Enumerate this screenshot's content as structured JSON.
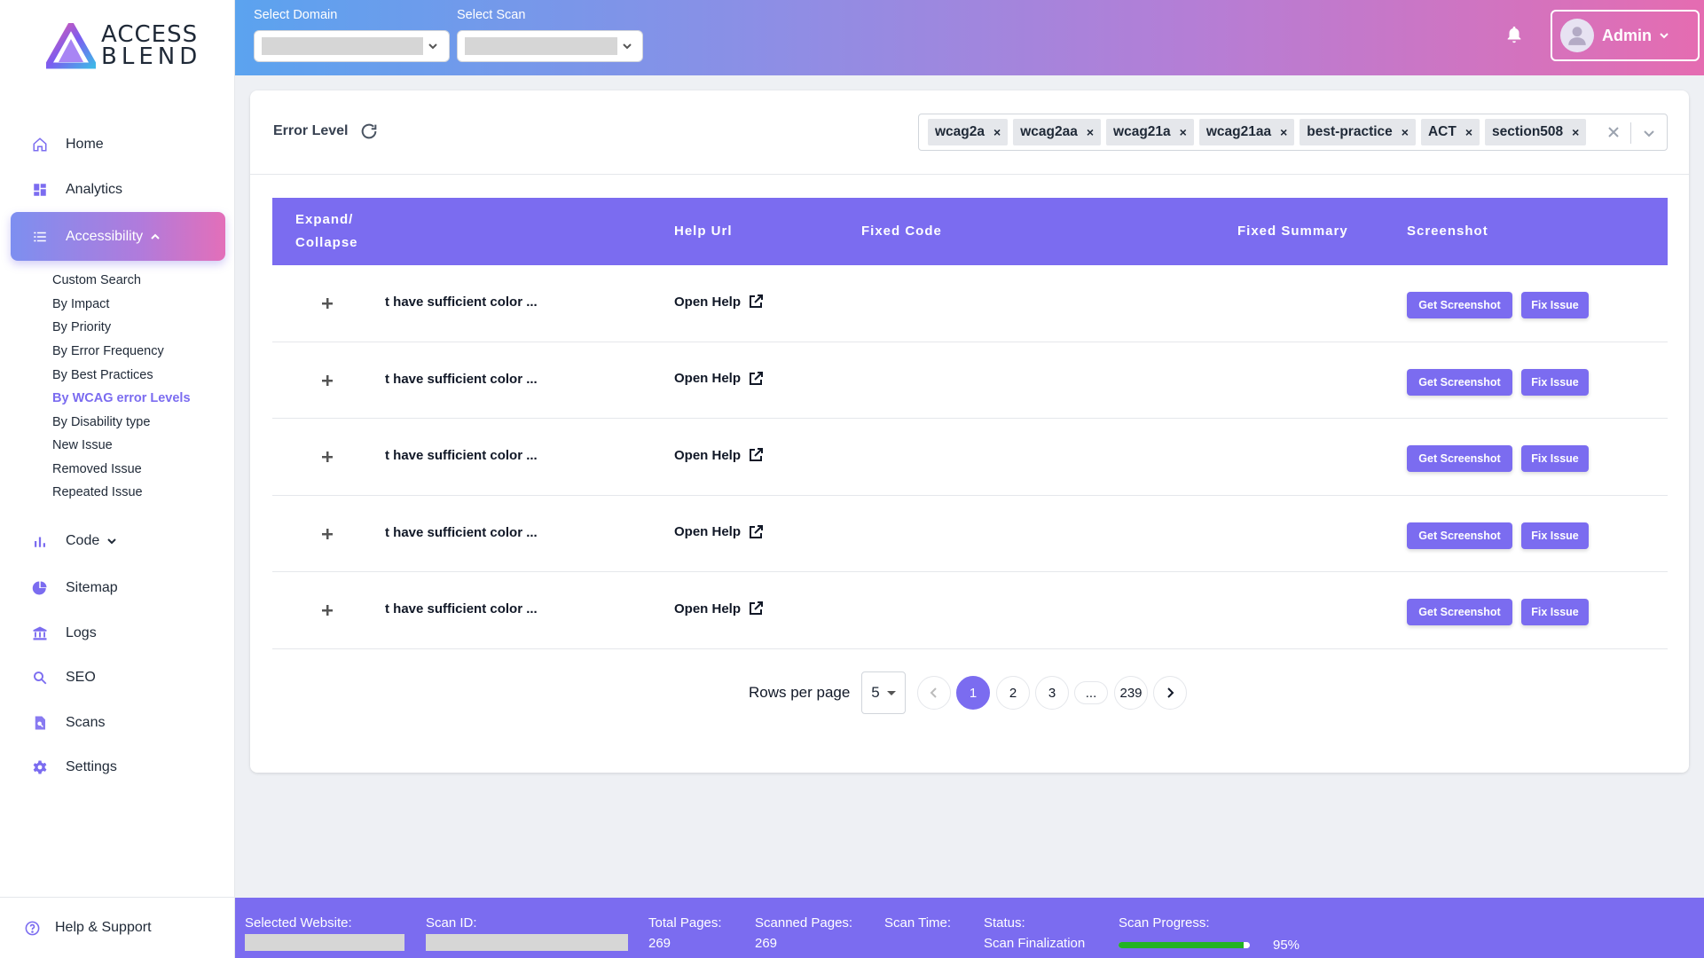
{
  "app": {
    "logo_line1": "ACCESS",
    "logo_line2": "BLEND"
  },
  "sidebar": {
    "items": [
      {
        "label": "Home",
        "icon": "home-icon"
      },
      {
        "label": "Analytics",
        "icon": "dashboard-icon"
      },
      {
        "label": "Accessibility",
        "icon": "list-icon",
        "active": true,
        "expanded": true
      },
      {
        "label": "Code",
        "icon": "bar-chart-icon",
        "expanded": false
      },
      {
        "label": "Sitemap",
        "icon": "pie-chart-icon"
      },
      {
        "label": "Logs",
        "icon": "bank-icon"
      },
      {
        "label": "SEO",
        "icon": "search-icon"
      },
      {
        "label": "Scans",
        "icon": "scan-search-icon"
      },
      {
        "label": "Settings",
        "icon": "gear-icon"
      }
    ],
    "subitems": [
      {
        "label": "Custom Search"
      },
      {
        "label": "By Impact"
      },
      {
        "label": "By Priority"
      },
      {
        "label": "By Error Frequency"
      },
      {
        "label": "By Best Practices"
      },
      {
        "label": "By WCAG error Levels",
        "active": true
      },
      {
        "label": "By Disability type"
      },
      {
        "label": "New Issue"
      },
      {
        "label": "Removed Issue"
      },
      {
        "label": "Repeated Issue"
      }
    ],
    "help": "Help & Support"
  },
  "header": {
    "domain_label": "Select Domain",
    "scan_label": "Select Scan",
    "user": "Admin"
  },
  "filter": {
    "title": "Error Level",
    "tags": [
      "wcag2a",
      "wcag2aa",
      "wcag21a",
      "wcag21aa",
      "best-practice",
      "ACT",
      "section508"
    ],
    "tag_remove": "×"
  },
  "table": {
    "headers": {
      "expand_line1": "Expand/",
      "expand_line2": "Collapse",
      "help_url": "Help Url",
      "fixed_code": "Fixed Code",
      "fixed_summary": "Fixed Summary",
      "screenshot": "Screenshot"
    },
    "rows": [
      {
        "desc": "t have sufficient color ...",
        "help": "Open Help",
        "shot": "Get Screenshot",
        "fix": "Fix Issue"
      },
      {
        "desc": "t have sufficient color ...",
        "help": "Open Help",
        "shot": "Get Screenshot",
        "fix": "Fix Issue"
      },
      {
        "desc": "t have sufficient color ...",
        "help": "Open Help",
        "shot": "Get Screenshot",
        "fix": "Fix Issue"
      },
      {
        "desc": "t have sufficient color ...",
        "help": "Open Help",
        "shot": "Get Screenshot",
        "fix": "Fix Issue"
      },
      {
        "desc": "t have sufficient color ...",
        "help": "Open Help",
        "shot": "Get Screenshot",
        "fix": "Fix Issue"
      }
    ]
  },
  "pagination": {
    "rows_per_page_label": "Rows per page",
    "rows_per_page": "5",
    "pages": [
      "1",
      "2",
      "3",
      "...",
      "239"
    ],
    "current_page": "1"
  },
  "footer": {
    "website_label": "Selected Website:",
    "scan_id_label": "Scan ID:",
    "total_pages_label": "Total Pages:",
    "total_pages": "269",
    "scanned_pages_label": "Scanned Pages:",
    "scanned_pages": "269",
    "scan_time_label": "Scan Time:",
    "status_label": "Status:",
    "status": "Scan Finalization",
    "progress_label": "Scan Progress:",
    "progress_text": "95%",
    "progress": 0.95
  },
  "colors": {
    "accent": "#7b6cf0",
    "progress": "#22b322"
  }
}
